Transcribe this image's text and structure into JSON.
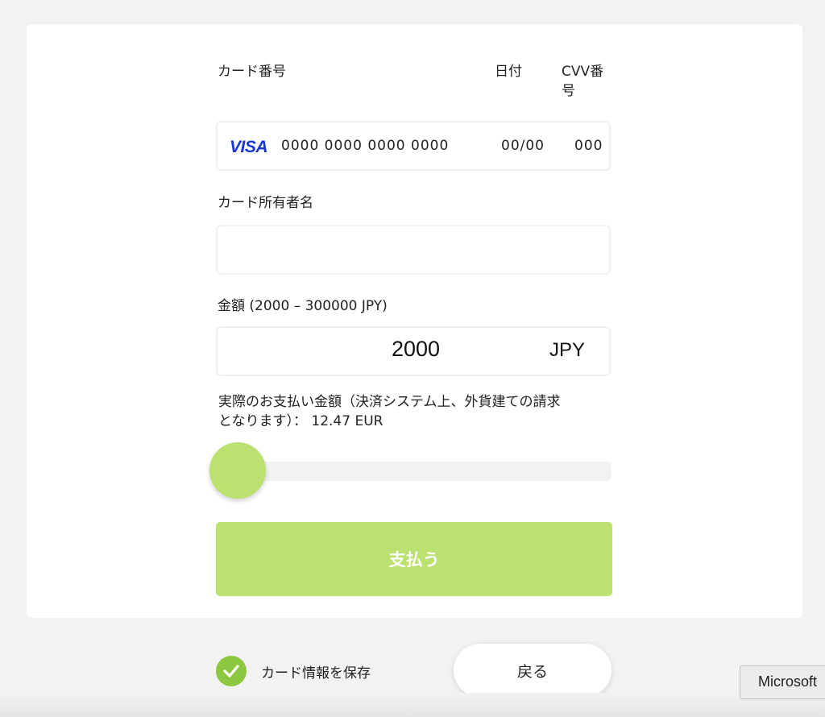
{
  "labels": {
    "card_number": "カード番号",
    "date": "日付",
    "cvv_line1": "CVV番",
    "cvv_line2": "号",
    "cardholder": "カード所有者名",
    "amount": "金額 (2000 – 300000 JPY)"
  },
  "card": {
    "brand": "VISA",
    "number_placeholder": "0000 0000 0000 0000",
    "expiry_placeholder": "00/00",
    "cvv_placeholder": "000"
  },
  "cardholder_value": "",
  "amount": {
    "value": "2000",
    "currency": "JPY",
    "slider_fraction": 0.0
  },
  "note": {
    "line1": "実際のお支払い金額（決済システム上、外貨建ての請求",
    "line2": "となります）： 12.47 EUR"
  },
  "pay_button": "支払う",
  "save_card": {
    "label": "カード情報を保存",
    "checked": true
  },
  "back_button": "戻る",
  "tooltip": "Microsoft",
  "colors": {
    "accent": "#bbe271",
    "check": "#8dc63f",
    "visa": "#1a35d6"
  }
}
